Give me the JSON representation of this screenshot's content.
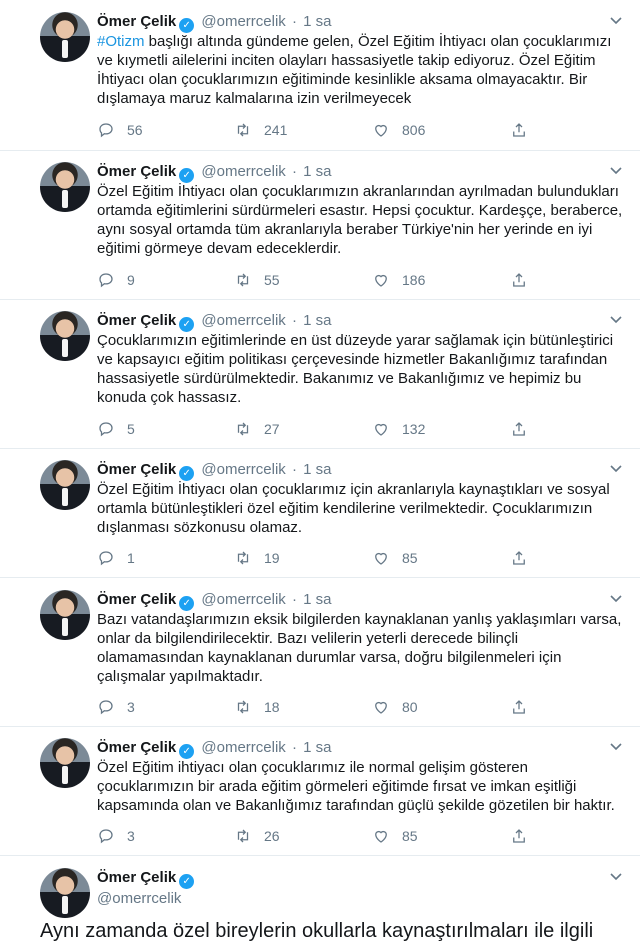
{
  "author": {
    "name": "Ömer Çelik",
    "handle": "@omerrcelik",
    "dot": "·",
    "verified_glyph": "✓"
  },
  "tweets": [
    {
      "time": "1 sa",
      "hashtag": "#Otizm",
      "text": " başlığı altında gündeme gelen, Özel Eğitim İhtiyacı olan çocuklarımızı\nve kıymetli ailelerini inciten olayları hassasiyetle takip ediyoruz. Özel Eğitim\nİhtiyacı olan çocuklarımızın eğitiminde kesinlikle aksama olmayacaktır. Bir\ndışlamaya maruz kalmalarına izin verilmeyecek",
      "replies": "56",
      "retweets": "241",
      "likes": "806"
    },
    {
      "time": "1 sa",
      "text": "Özel Eğitim İhtiyacı olan çocuklarımızın akranlarından ayrılmadan bulundukları\nortamda eğitimlerini sürdürmeleri esastır. Hepsi çocuktur. Kardeşçe, beraberce,\naynı sosyal ortamda tüm akranlarıyla beraber Türkiye'nin her yerinde en iyi\neğitimi görmeye devam edeceklerdir.",
      "replies": "9",
      "retweets": "55",
      "likes": "186"
    },
    {
      "time": "1 sa",
      "text": "Çocuklarımızın eğitimlerinde en üst düzeyde yarar sağlamak için bütünleştirici\nve kapsayıcı eğitim politikası çerçevesinde hizmetler Bakanlığımız tarafından\nhassasiyetle sürdürülmektedir. Bakanımız ve Bakanlığımız ve hepimiz bu\nkonuda çok hassasız.",
      "replies": "5",
      "retweets": "27",
      "likes": "132"
    },
    {
      "time": "1 sa",
      "text": "Özel Eğitim İhtiyacı olan çocuklarımız için akranlarıyla kaynaştıkları ve sosyal\nortamla bütünleştikleri özel eğitim kendilerine verilmektedir. Çocuklarımızın\ndışlanması sözkonusu olamaz.",
      "replies": "1",
      "retweets": "19",
      "likes": "85"
    },
    {
      "time": "1 sa",
      "text": "Bazı vatandaşlarımızın eksik bilgilerden kaynaklanan yanlış yaklaşımları varsa,\nonlar da bilgilendirilecektir. Bazı velilerin yeterli derecede bilinçli\nolamamasından kaynaklanan durumlar varsa, doğru bilgilenmeleri için\nçalışmalar yapılmaktadır.",
      "replies": "3",
      "retweets": "18",
      "likes": "80"
    },
    {
      "time": "1 sa",
      "text": "Özel Eğitim ihtiyacı olan çocuklarımız ile normal gelişim gösteren\nçocuklarımızın bir arada eğitim görmeleri eğitimde fırsat ve imkan eşitliği\nkapsamında olan ve Bakanlığımız tarafından güçlü şekilde gözetilen bir haktır.",
      "replies": "3",
      "retweets": "26",
      "likes": "85"
    }
  ],
  "cut_text": "Aynı zamanda özel bireylerin okullarla kaynaştırılmaları ile ilgili"
}
